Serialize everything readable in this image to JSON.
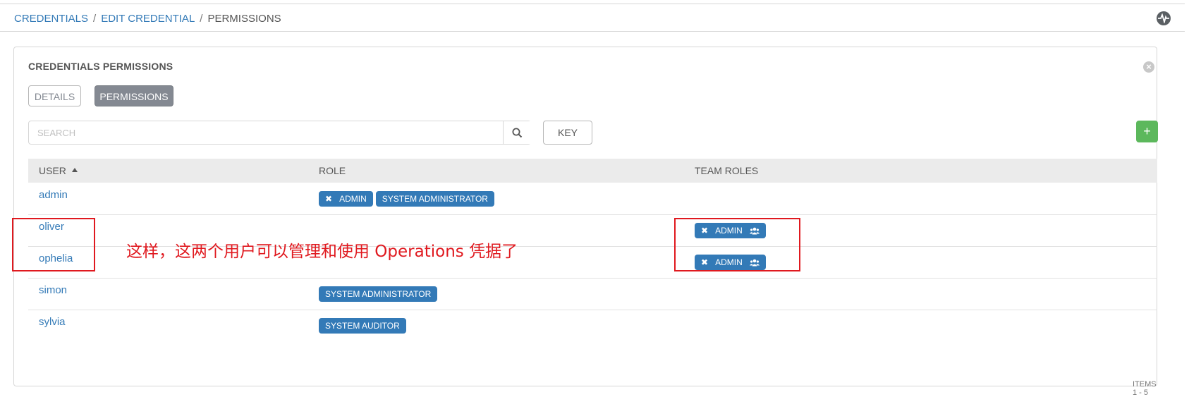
{
  "breadcrumb": {
    "items": [
      "CREDENTIALS",
      "EDIT CREDENTIAL"
    ],
    "separator": "/",
    "current": "PERMISSIONS"
  },
  "panel": {
    "title": "CREDENTIALS PERMISSIONS",
    "tabs": [
      {
        "label": "DETAILS",
        "active": false
      },
      {
        "label": "PERMISSIONS",
        "active": true
      }
    ]
  },
  "toolbar": {
    "search_placeholder": "SEARCH",
    "key_label": "KEY",
    "add_label": "+"
  },
  "table": {
    "columns": [
      "USER",
      "ROLE",
      "TEAM ROLES"
    ],
    "sort": {
      "column": "USER",
      "direction": "ascending"
    },
    "rows": [
      {
        "user": "admin",
        "roles": [
          {
            "label": "ADMIN",
            "removable": true
          },
          {
            "label": "SYSTEM ADMINISTRATOR",
            "removable": false
          }
        ],
        "team_roles": []
      },
      {
        "user": "oliver",
        "roles": [],
        "team_roles": [
          {
            "label": "ADMIN",
            "removable": true,
            "icon": "users-icon"
          }
        ]
      },
      {
        "user": "ophelia",
        "roles": [],
        "team_roles": [
          {
            "label": "ADMIN",
            "removable": true,
            "icon": "users-icon"
          }
        ]
      },
      {
        "user": "simon",
        "roles": [
          {
            "label": "SYSTEM ADMINISTRATOR",
            "removable": false
          }
        ],
        "team_roles": []
      },
      {
        "user": "sylvia",
        "roles": [
          {
            "label": "SYSTEM AUDITOR",
            "removable": false
          }
        ],
        "team_roles": []
      }
    ]
  },
  "pagination": {
    "items_label": "ITEMS 1 - 5"
  },
  "annotation": {
    "text": "这样，这两个用户可以管理和使用 Operations 凭据了",
    "color": "#e0191f"
  },
  "colors": {
    "link": "#337ab7",
    "tag": "#337ab7",
    "active_tab": "#848992",
    "add_button": "#5cb85c"
  }
}
